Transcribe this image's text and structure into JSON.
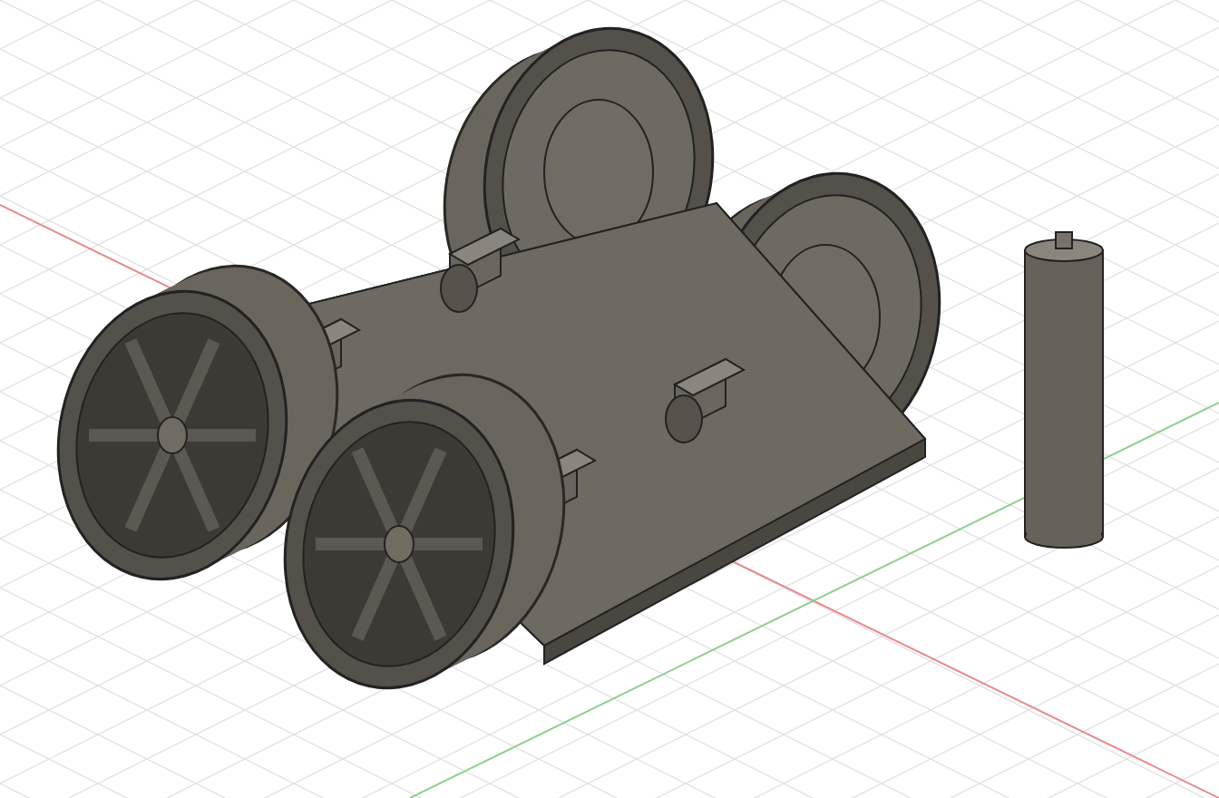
{
  "viewport": {
    "kind": "iso-grid"
  }
}
